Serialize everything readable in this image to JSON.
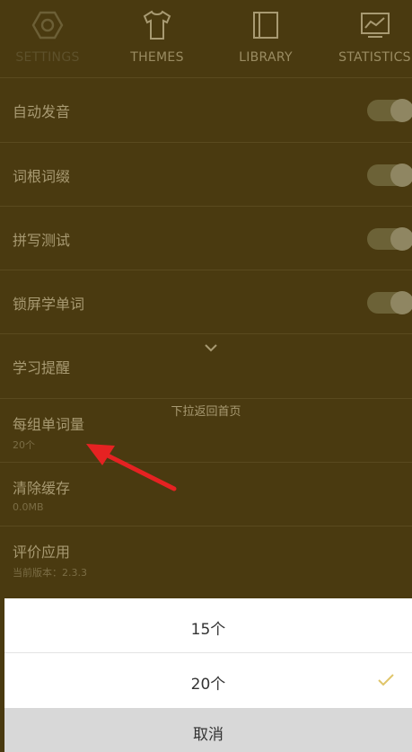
{
  "tabs": [
    {
      "label": "SETTINGS",
      "icon": "hexagon-settings-icon",
      "active": true
    },
    {
      "label": "THEMES",
      "icon": "tshirt-icon",
      "active": false
    },
    {
      "label": "LIBRARY",
      "icon": "book-icon",
      "active": false
    },
    {
      "label": "STATISTICS",
      "icon": "chart-icon",
      "active": false
    }
  ],
  "settings": [
    {
      "title": "自动发音",
      "toggle": true
    },
    {
      "title": "词根词缀",
      "toggle": true
    },
    {
      "title": "拼写测试",
      "toggle": true
    },
    {
      "title": "锁屏学单词",
      "toggle": true
    },
    {
      "title": "学习提醒"
    },
    {
      "title": "每组单词量",
      "sub": "20个"
    },
    {
      "title": "清除缓存",
      "sub": "0.0MB"
    },
    {
      "title": "评价应用",
      "sub": "当前版本：2.3.3"
    }
  ],
  "pull_hint": "下拉返回首页",
  "sheet": {
    "options": [
      {
        "label": "15个",
        "selected": false
      },
      {
        "label": "20个",
        "selected": true
      }
    ],
    "cancel": "取消"
  },
  "colors": {
    "background": "#4a3a10",
    "accent_check": "#e0c56a",
    "annotation_arrow": "#e52222"
  }
}
